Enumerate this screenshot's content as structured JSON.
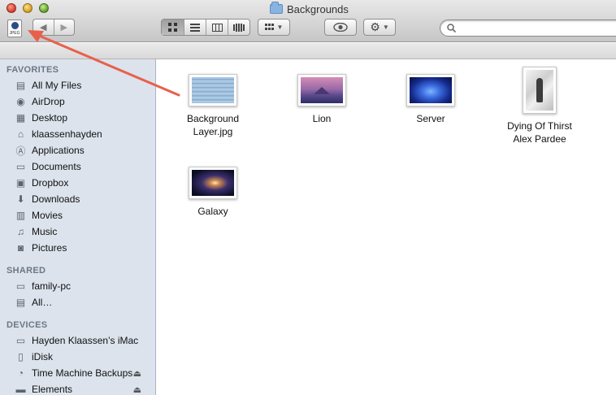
{
  "window": {
    "title": "Backgrounds",
    "proxy_icon_label": "JPEG"
  },
  "toolbar": {
    "back_icon": "◀",
    "forward_icon": "▶",
    "view_modes": [
      "icon-view",
      "list-view",
      "column-view",
      "cover-flow-view"
    ],
    "active_view": "icon-view",
    "arrange_icon": "grid-icon",
    "quicklook_icon": "eye-icon",
    "action_icon": "gear-icon",
    "search_placeholder": ""
  },
  "sidebar": {
    "favorites_header": "FAVORITES",
    "favorites": [
      {
        "label": "All My Files",
        "icon": "all-files-icon"
      },
      {
        "label": "AirDrop",
        "icon": "airdrop-icon"
      },
      {
        "label": "Desktop",
        "icon": "desktop-icon"
      },
      {
        "label": "klaassenhayden",
        "icon": "home-icon"
      },
      {
        "label": "Applications",
        "icon": "applications-icon"
      },
      {
        "label": "Documents",
        "icon": "documents-icon"
      },
      {
        "label": "Dropbox",
        "icon": "dropbox-icon"
      },
      {
        "label": "Downloads",
        "icon": "downloads-icon"
      },
      {
        "label": "Movies",
        "icon": "movies-icon"
      },
      {
        "label": "Music",
        "icon": "music-icon"
      },
      {
        "label": "Pictures",
        "icon": "pictures-icon"
      }
    ],
    "shared_header": "SHARED",
    "shared": [
      {
        "label": "family-pc",
        "icon": "computer-icon"
      },
      {
        "label": "All…",
        "icon": "network-icon"
      }
    ],
    "devices_header": "DEVICES",
    "devices": [
      {
        "label": "Hayden Klaassen’s iMac",
        "icon": "imac-icon"
      },
      {
        "label": "iDisk",
        "icon": "idisk-icon"
      },
      {
        "label": "Time Machine Backups",
        "icon": "time-machine-icon",
        "eject": "⏏"
      },
      {
        "label": "Elements",
        "icon": "external-drive-icon",
        "eject": "⏏"
      }
    ]
  },
  "files": [
    {
      "label": "Background\nLayer.jpg",
      "thumb": "background-layer"
    },
    {
      "label": "Lion",
      "thumb": "lion"
    },
    {
      "label": "Server",
      "thumb": "server"
    },
    {
      "label": "Dying Of Thirst\nAlex Pardee",
      "thumb": "dying-of-thirst"
    },
    {
      "label": "Galaxy",
      "thumb": "galaxy"
    }
  ],
  "annotation": {
    "arrow_color": "#e8604c"
  }
}
